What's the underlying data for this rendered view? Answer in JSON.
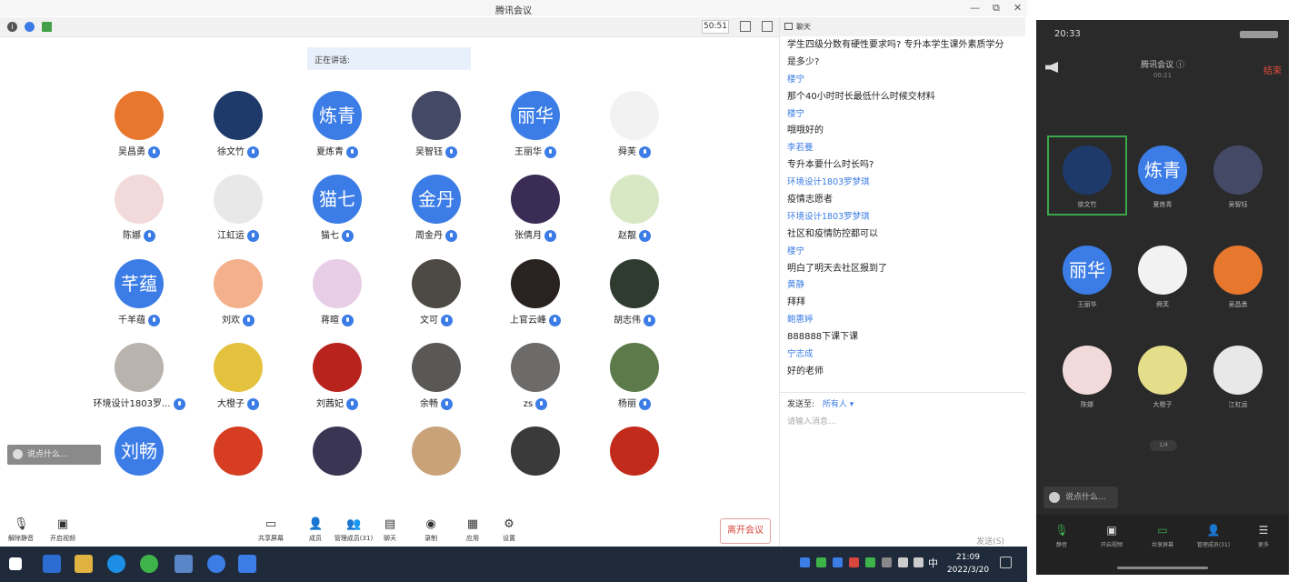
{
  "window": {
    "title": "腾讯会议"
  },
  "statusbar": {
    "timer": "50:51"
  },
  "speaking": {
    "label": "正在讲话:"
  },
  "participants": [
    {
      "name": "吴昌勇",
      "avatar": "",
      "color": "#e8772e"
    },
    {
      "name": "徐文竹",
      "avatar": "",
      "color": "#1e3a6b"
    },
    {
      "name": "夏炼青",
      "avatar": "炼青",
      "color": "#3b7ce6"
    },
    {
      "name": "吴智钰",
      "avatar": "",
      "color": "#444a66"
    },
    {
      "name": "王丽华",
      "avatar": "丽华",
      "color": "#3b7ce6"
    },
    {
      "name": "舜芙",
      "avatar": "",
      "color": "#f2f2f2"
    },
    {
      "name": "陈娜",
      "avatar": "",
      "color": "#f3dada"
    },
    {
      "name": "江虹运",
      "avatar": "",
      "color": "#e8e8e8"
    },
    {
      "name": "猫七",
      "avatar": "猫七",
      "color": "#3b7ce6"
    },
    {
      "name": "周金丹",
      "avatar": "金丹",
      "color": "#3b7ce6"
    },
    {
      "name": "张倩月",
      "avatar": "",
      "color": "#3b2c55"
    },
    {
      "name": "赵靓",
      "avatar": "",
      "color": "#d8e7c4"
    },
    {
      "name": "千羊蕴",
      "avatar": "芊蕴",
      "color": "#3b7ce6"
    },
    {
      "name": "刘欢",
      "avatar": "",
      "color": "#f3b08a"
    },
    {
      "name": "蒋暄",
      "avatar": "",
      "color": "#e7cde6"
    },
    {
      "name": "文可",
      "avatar": "",
      "color": "#4d4a46"
    },
    {
      "name": "上官云峰",
      "avatar": "",
      "color": "#2a2220"
    },
    {
      "name": "胡志伟",
      "avatar": "",
      "color": "#2f3b2f"
    },
    {
      "name": "环境设计1803罗...",
      "avatar": "",
      "color": "#b8b3ad"
    },
    {
      "name": "大橙子",
      "avatar": "",
      "color": "#e4c23e"
    },
    {
      "name": "刘茜妃",
      "avatar": "",
      "color": "#b8231d"
    },
    {
      "name": "余畅",
      "avatar": "",
      "color": "#5a5856"
    },
    {
      "name": "zs",
      "avatar": "",
      "color": "#6d6a6a"
    },
    {
      "name": "杨丽",
      "avatar": "",
      "color": "#5d7a4a"
    },
    {
      "name": "",
      "avatar": "刘畅",
      "color": "#3b7ce6"
    },
    {
      "name": "",
      "avatar": "",
      "color": "#d63d22"
    },
    {
      "name": "",
      "avatar": "",
      "color": "#393552"
    },
    {
      "name": "",
      "avatar": "",
      "color": "#c9a27a"
    },
    {
      "name": "",
      "avatar": "",
      "color": "#3a3a3a"
    },
    {
      "name": "",
      "avatar": "",
      "color": "#c22a1c"
    }
  ],
  "float_chat": {
    "placeholder": "说点什么..."
  },
  "toolbar": {
    "items": [
      {
        "label": "解除静音",
        "icon": "mic-off-icon"
      },
      {
        "label": "开启视频",
        "icon": "video-off-icon"
      },
      {
        "label": "共享屏幕",
        "icon": "share-screen-icon"
      },
      {
        "label": "成员",
        "icon": "invite-icon"
      },
      {
        "label": "管理成员(31)",
        "icon": "members-icon"
      },
      {
        "label": "聊天",
        "icon": "chat-icon"
      },
      {
        "label": "录制",
        "icon": "record-icon"
      },
      {
        "label": "应用",
        "icon": "apps-icon"
      },
      {
        "label": "设置",
        "icon": "settings-icon"
      }
    ],
    "leave": "离开会议"
  },
  "chat": {
    "title": "聊天",
    "messages": [
      {
        "kind": "text",
        "text": "学生四级分数有硬性要求吗? 专升本学生课外素质学分"
      },
      {
        "kind": "text",
        "text": "是多少?"
      },
      {
        "kind": "sender",
        "text": "楼宁"
      },
      {
        "kind": "text",
        "text": "那个40小时时长最低什么时候交材料"
      },
      {
        "kind": "sender",
        "text": "楼宁"
      },
      {
        "kind": "text",
        "text": "哦哦好的"
      },
      {
        "kind": "sender",
        "text": "李若曼"
      },
      {
        "kind": "text",
        "text": "专升本要什么时长吗?"
      },
      {
        "kind": "sender",
        "text": "环境设计1803罗梦琪"
      },
      {
        "kind": "text",
        "text": "疫情志愿者"
      },
      {
        "kind": "sender",
        "text": "环境设计1803罗梦琪"
      },
      {
        "kind": "text",
        "text": "社区和疫情防控都可以"
      },
      {
        "kind": "sender",
        "text": "楼宁"
      },
      {
        "kind": "text",
        "text": "明白了明天去社区报到了"
      },
      {
        "kind": "sender",
        "text": "黄静"
      },
      {
        "kind": "text",
        "text": "拜拜"
      },
      {
        "kind": "sender",
        "text": "鲍惠婷"
      },
      {
        "kind": "text",
        "text": "888888下课下课"
      },
      {
        "kind": "sender",
        "text": "宁志成"
      },
      {
        "kind": "text",
        "text": "好的老师"
      }
    ],
    "send_to_label": "发送至:",
    "send_to_value": "所有人 ▾",
    "input_placeholder": "请输入消息...",
    "send_button": "发送(S)"
  },
  "taskbar": {
    "time": "21:09",
    "date": "2022/3/20",
    "ime": "中"
  },
  "phone": {
    "time": "20:33",
    "title": "腾讯会议 ⓘ",
    "subtitle": "00:21",
    "end": "结束",
    "participants": [
      {
        "name": "徐文竹",
        "avatar": "",
        "color": "#1e3a6b"
      },
      {
        "name": "夏炼青",
        "avatar": "炼青",
        "color": "#3b7ce6"
      },
      {
        "name": "吴智钰",
        "avatar": "",
        "color": "#444a66"
      },
      {
        "name": "王丽华",
        "avatar": "丽华",
        "color": "#3b7ce6"
      },
      {
        "name": "舜芙",
        "avatar": "",
        "color": "#f2f2f2"
      },
      {
        "name": "吴昌勇",
        "avatar": "",
        "color": "#e8772e"
      },
      {
        "name": "陈娜",
        "avatar": "",
        "color": "#f3dada"
      },
      {
        "name": "大橙子",
        "avatar": "",
        "color": "#e4dd8a"
      },
      {
        "name": "江虹运",
        "avatar": "",
        "color": "#e8e8e8"
      }
    ],
    "page_dots": "1/4",
    "chat_placeholder": "说点什么...",
    "toolbar": [
      "静音",
      "开启视频",
      "共享屏幕",
      "管理成员(31)",
      "更多"
    ]
  }
}
